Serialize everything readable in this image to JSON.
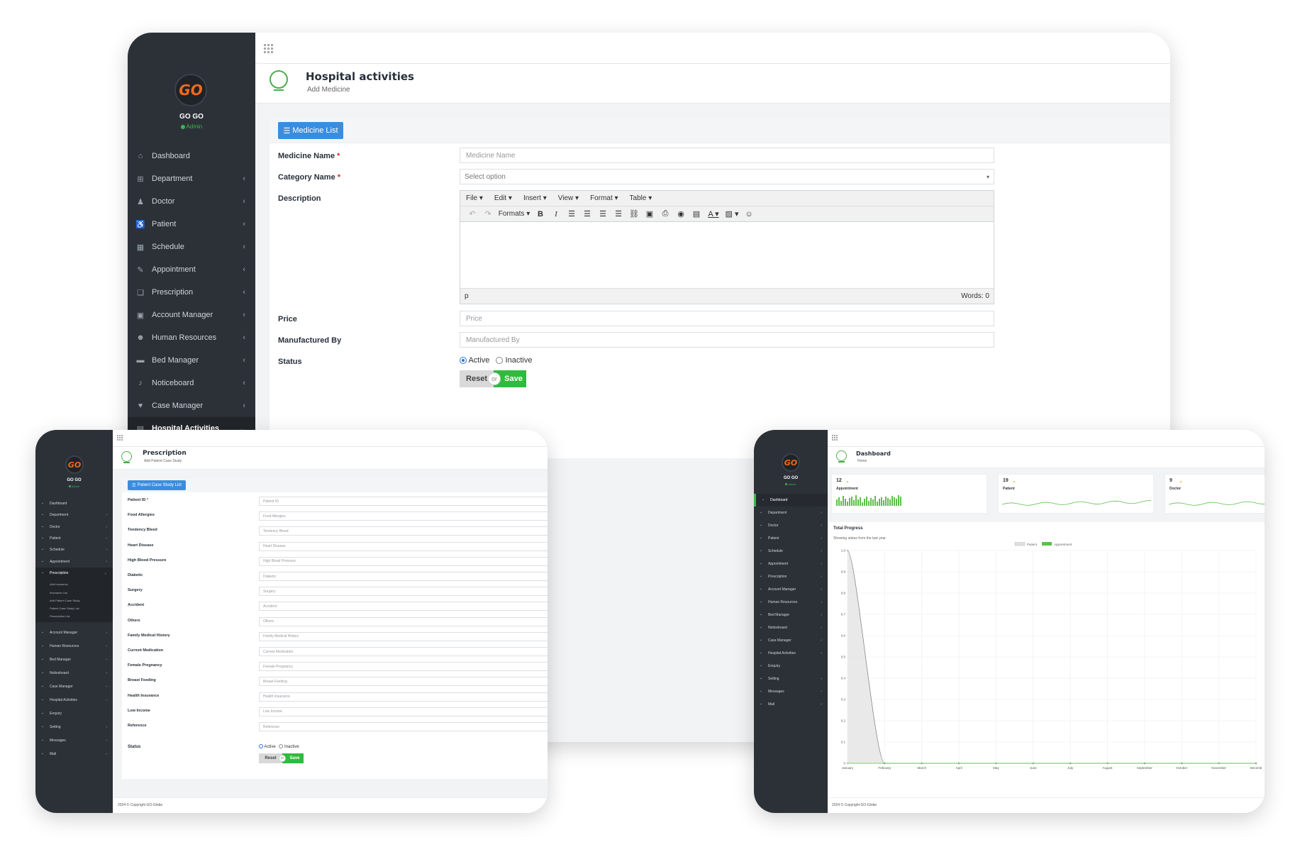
{
  "main": {
    "brand": "GO GO",
    "role": "Admin",
    "logo": "GO",
    "page_title": "Hospital activities",
    "page_subtitle": "Add Medicine",
    "menu": [
      {
        "label": "Dashboard",
        "icon": "home-icon",
        "chevron": false
      },
      {
        "label": "Department",
        "icon": "sitemap-icon",
        "chevron": true
      },
      {
        "label": "Doctor",
        "icon": "user-md-icon",
        "chevron": true
      },
      {
        "label": "Patient",
        "icon": "wheelchair-icon",
        "chevron": true
      },
      {
        "label": "Schedule",
        "icon": "calendar-icon",
        "chevron": true
      },
      {
        "label": "Appointment",
        "icon": "edit-icon",
        "chevron": true
      },
      {
        "label": "Prescription",
        "icon": "book-icon",
        "chevron": true
      },
      {
        "label": "Account Manager",
        "icon": "money-icon",
        "chevron": true
      },
      {
        "label": "Human Resources",
        "icon": "users-icon",
        "chevron": true
      },
      {
        "label": "Bed Manager",
        "icon": "bed-icon",
        "chevron": true
      },
      {
        "label": "Noticeboard",
        "icon": "bell-icon",
        "chevron": true
      },
      {
        "label": "Case Manager",
        "icon": "heartbeat-icon",
        "chevron": true
      },
      {
        "label": "Hospital Activities",
        "icon": "clipboard-icon",
        "chevron": true,
        "active": true
      }
    ],
    "list_button": "Medicine List",
    "fields": {
      "medicine_name_label": "Medicine Name",
      "medicine_name_placeholder": "Medicine Name",
      "category_label": "Category Name",
      "category_placeholder": "Select option",
      "description_label": "Description",
      "price_label": "Price",
      "price_placeholder": "Price",
      "manufactured_label": "Manufactured By",
      "manufactured_placeholder": "Manufactured By",
      "status_label": "Status",
      "status_active": "Active",
      "status_inactive": "Inactive",
      "status_selected": "Active",
      "required_mark": "*"
    },
    "editor": {
      "menus": [
        "File",
        "Edit",
        "Insert",
        "View",
        "Format",
        "Table"
      ],
      "formats_label": "Formats",
      "status_path": "p",
      "word_count": "Words: 0"
    },
    "buttons": {
      "reset": "Reset",
      "or": "or",
      "save": "Save"
    }
  },
  "left_device": {
    "brand": "GO GO",
    "role": "Admin",
    "logo": "GO",
    "page_title": "Prescription",
    "page_subtitle": "Add Patient Case Study",
    "menu": [
      {
        "label": "Dashboard",
        "chevron": false
      },
      {
        "label": "Department",
        "chevron": true
      },
      {
        "label": "Doctor",
        "chevron": true
      },
      {
        "label": "Patient",
        "chevron": true
      },
      {
        "label": "Schedule",
        "chevron": true
      },
      {
        "label": "Appointment",
        "chevron": true
      },
      {
        "label": "Prescription",
        "chevron": true,
        "active": true
      }
    ],
    "submenu": [
      "Add Insurance",
      "Insurance List",
      "Add Patient Case Study",
      "Patient Case Study List",
      "Prescription List"
    ],
    "menu_after": [
      {
        "label": "Account Manager",
        "chevron": true
      },
      {
        "label": "Human Resources",
        "chevron": true
      },
      {
        "label": "Bed Manager",
        "chevron": true
      },
      {
        "label": "Noticeboard",
        "chevron": true
      },
      {
        "label": "Case Manager",
        "chevron": true
      },
      {
        "label": "Hospital Activities",
        "chevron": true
      },
      {
        "label": "Enquiry",
        "chevron": false
      },
      {
        "label": "Setting",
        "chevron": true
      },
      {
        "label": "Messages",
        "chevron": true
      },
      {
        "label": "Mail",
        "chevron": true
      }
    ],
    "list_button": "Patient Case Study List",
    "fields": [
      {
        "label": "Patient ID",
        "placeholder": "Patient ID",
        "required": true
      },
      {
        "label": "Food Allergies",
        "placeholder": "Food Allergies"
      },
      {
        "label": "Tendency Bleed",
        "placeholder": "Tendency Bleed"
      },
      {
        "label": "Heart Disease",
        "placeholder": "Heart Disease"
      },
      {
        "label": "High Blood Pressure",
        "placeholder": "High Blood Pressure"
      },
      {
        "label": "Diabetic",
        "placeholder": "Diabetic"
      },
      {
        "label": "Surgery",
        "placeholder": "Surgery"
      },
      {
        "label": "Accident",
        "placeholder": "Accident"
      },
      {
        "label": "Others",
        "placeholder": "Others"
      },
      {
        "label": "Family Medical History",
        "placeholder": "Family Medical History"
      },
      {
        "label": "Current Medication",
        "placeholder": "Current Medication"
      },
      {
        "label": "Female Pregnancy",
        "placeholder": "Female Pregnancy"
      },
      {
        "label": "Breast Feeding",
        "placeholder": "Breast Feeding"
      },
      {
        "label": "Health Insurance",
        "placeholder": "Health Insurance"
      },
      {
        "label": "Low Income",
        "placeholder": "Low Income"
      },
      {
        "label": "Reference",
        "placeholder": "Reference"
      }
    ],
    "status_label": "Status",
    "status_active": "Active",
    "status_inactive": "Inactive",
    "buttons": {
      "reset": "Reset",
      "or": "or",
      "save": "Save"
    },
    "footer": "2024 © Copyright GO-Globe"
  },
  "right_device": {
    "brand": "GO GO",
    "role": "Admin",
    "logo": "GO",
    "page_title": "Dashboard",
    "page_subtitle": "Home",
    "menu": [
      {
        "label": "Dashboard",
        "chevron": false,
        "active": true
      },
      {
        "label": "Department",
        "chevron": true
      },
      {
        "label": "Doctor",
        "chevron": true
      },
      {
        "label": "Patient",
        "chevron": true
      },
      {
        "label": "Schedule",
        "chevron": true
      },
      {
        "label": "Appointment",
        "chevron": true
      },
      {
        "label": "Prescription",
        "chevron": true
      },
      {
        "label": "Account Manager",
        "chevron": true
      },
      {
        "label": "Human Resources",
        "chevron": true
      },
      {
        "label": "Bed Manager",
        "chevron": true
      },
      {
        "label": "Noticeboard",
        "chevron": true
      },
      {
        "label": "Case Manager",
        "chevron": true
      },
      {
        "label": "Hospital Activities",
        "chevron": true
      },
      {
        "label": "Enquiry",
        "chevron": false
      },
      {
        "label": "Setting",
        "chevron": true
      },
      {
        "label": "Messages",
        "chevron": true
      },
      {
        "label": "Mail",
        "chevron": true
      }
    ],
    "stats": [
      {
        "value": "12",
        "label": "Appointment"
      },
      {
        "value": "19",
        "label": "Patient"
      },
      {
        "value": "9",
        "label": "Doctor"
      }
    ],
    "progress_title": "Total Progress",
    "progress_sub": "Showing status from the last year",
    "footer": "2024 © Copyright GO-Globe"
  },
  "chart_data": {
    "type": "area",
    "title": "Total Progress",
    "subtitle": "Showing status from the last year",
    "categories": [
      "January",
      "February",
      "March",
      "April",
      "May",
      "June",
      "July",
      "August",
      "September",
      "October",
      "November",
      "Decemb"
    ],
    "series": [
      {
        "name": "Patient",
        "values": [
          1.0,
          0,
          0,
          0,
          0,
          0,
          0,
          0,
          0,
          0,
          0,
          0
        ]
      },
      {
        "name": "Appointment",
        "values": [
          0,
          0,
          0,
          0,
          0,
          0,
          0,
          0,
          0,
          0,
          0,
          0
        ]
      }
    ],
    "yticks": [
      "1.0",
      "0.9",
      "0.8",
      "0.7",
      "0.6",
      "0.5",
      "0.4",
      "0.3",
      "0.2",
      "0.1",
      "0"
    ],
    "ylim": [
      0,
      1.0
    ],
    "legend_position": "top-center",
    "grid": true,
    "colors": {
      "Patient": "#e0e0e0",
      "Appointment": "#5cbf49"
    }
  },
  "colors": {
    "sidebar": "#2c3138",
    "accent_blue": "#3a8dde",
    "accent_green": "#2fbb3d",
    "logo_orange": "#f06a1d"
  }
}
